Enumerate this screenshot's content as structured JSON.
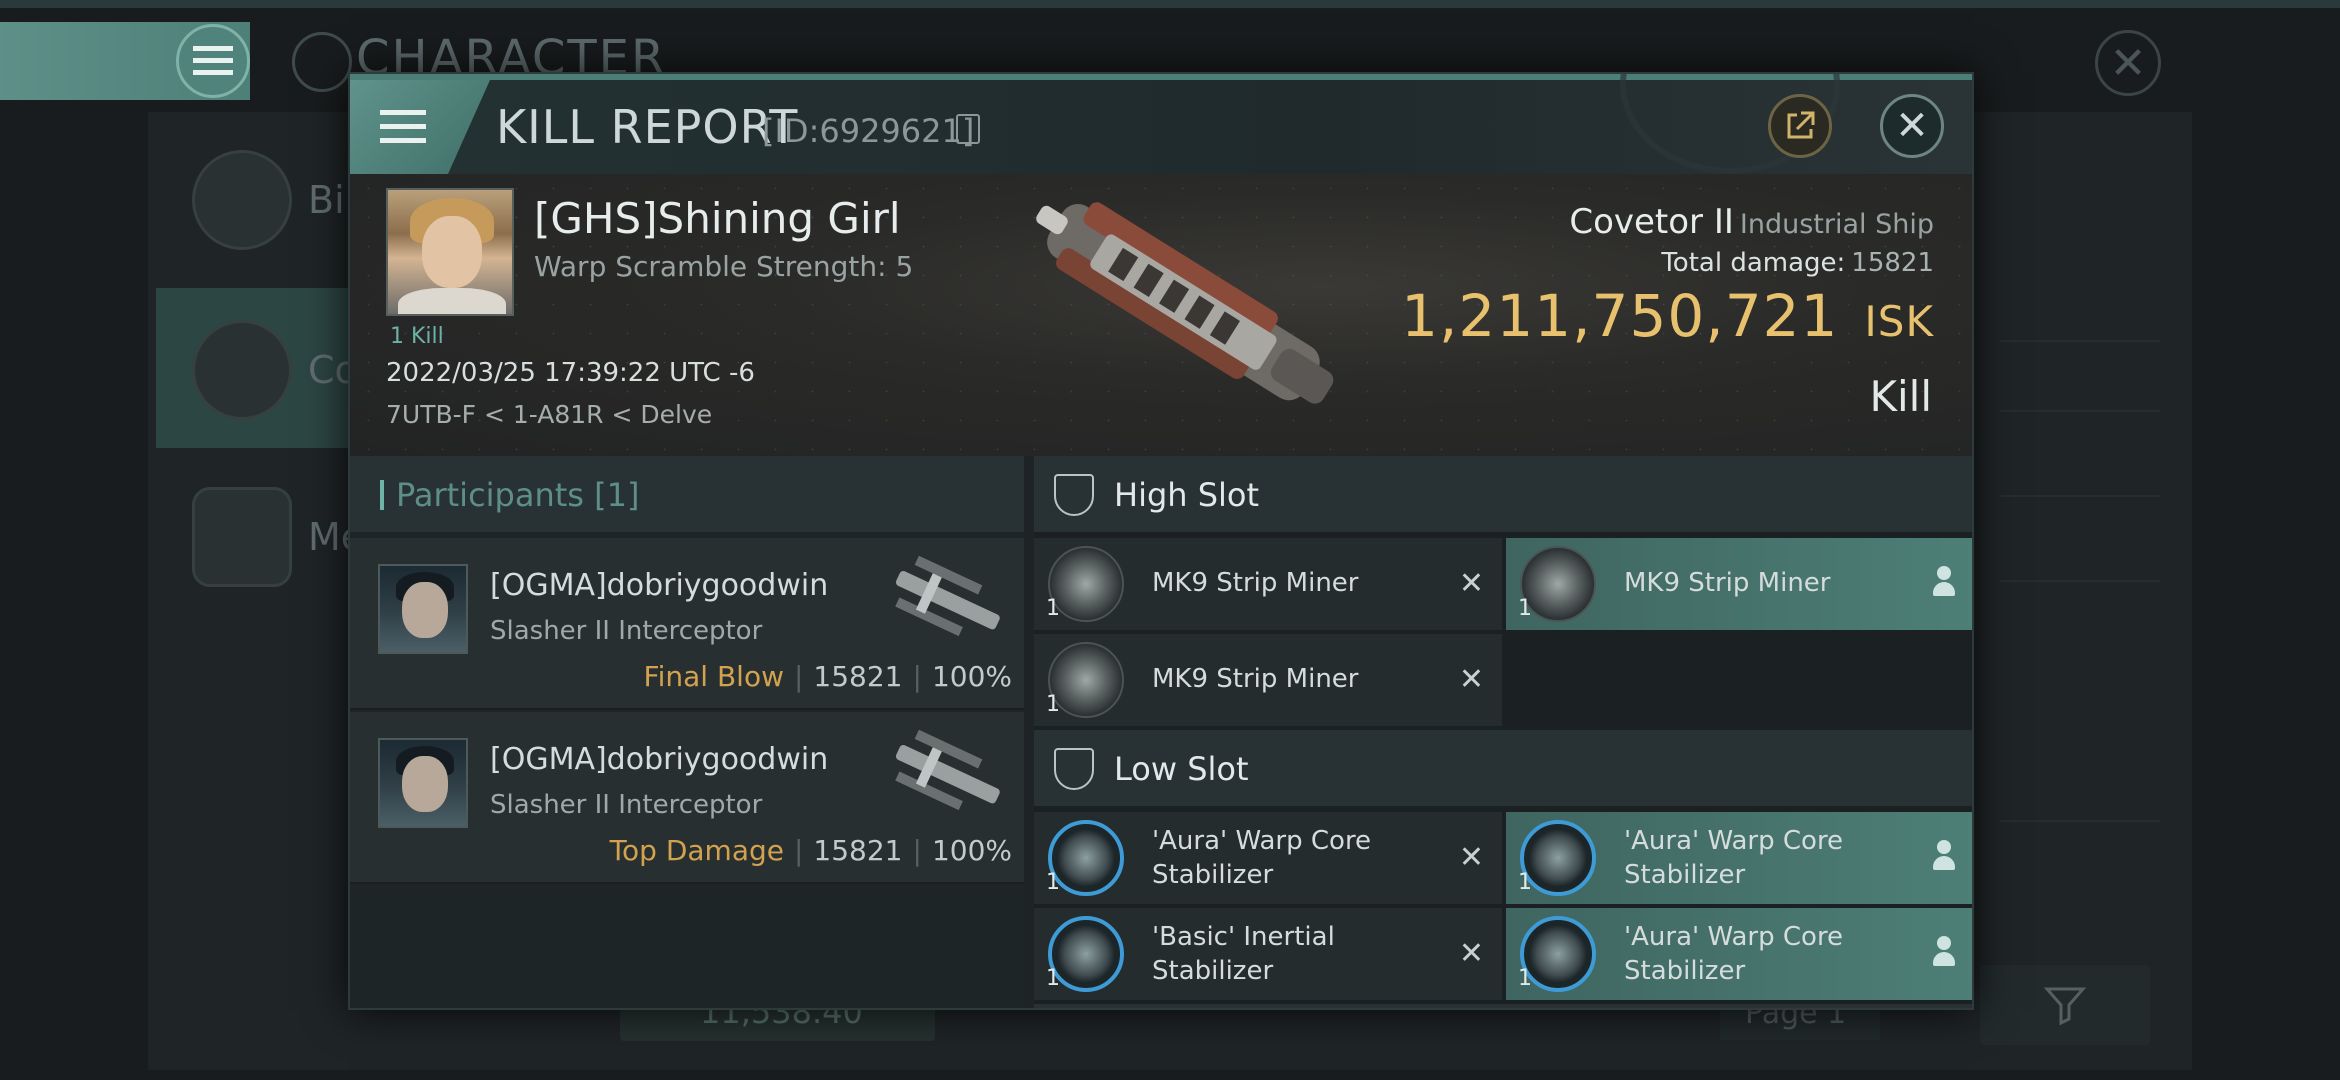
{
  "background": {
    "title": "CHARACTER",
    "side_items": [
      {
        "label": "Bi"
      },
      {
        "label": "Co"
      },
      {
        "label": "Me"
      }
    ],
    "bottom_value": "11,538.40",
    "page_label": "Page 1"
  },
  "modal": {
    "title": "KILL REPORT",
    "id_text": "[ID:6929621]",
    "victim": {
      "name": "[GHS]Shining Girl",
      "subtitle": "Warp Scramble Strength: 5",
      "kill_badge": "1 Kill",
      "datetime": "2022/03/25 17:39:22 UTC -6",
      "location": "7UTB-F < 1-A81R < Delve",
      "ship_name": "Covetor II",
      "ship_class": "Industrial Ship",
      "total_damage_label": "Total damage:",
      "total_damage": "15821",
      "isk_value": "1,211,750,721",
      "isk_unit": "ISK",
      "result": "Kill"
    },
    "participants": {
      "header": "Participants [1]",
      "rows": [
        {
          "name": "[OGMA]dobriygoodwin",
          "ship": "Slasher II Interceptor",
          "tag": "Final Blow",
          "damage": "15821",
          "percent": "100%"
        },
        {
          "name": "[OGMA]dobriygoodwin",
          "ship": "Slasher II Interceptor",
          "tag": "Top Damage",
          "damage": "15821",
          "percent": "100%"
        }
      ]
    },
    "high_slot": {
      "title": "High Slot",
      "items": [
        {
          "name": "MK9 Strip Miner",
          "qty": "1"
        },
        {
          "name": "MK9 Strip Miner",
          "qty": "1"
        },
        {
          "name": "MK9 Strip Miner",
          "qty": "1"
        }
      ]
    },
    "low_slot": {
      "title": "Low Slot",
      "items": [
        {
          "line1": "'Aura' Warp Core",
          "line2": "Stabilizer",
          "qty": "1"
        },
        {
          "line1": "'Aura' Warp Core",
          "line2": "Stabilizer",
          "qty": "1"
        },
        {
          "line1": "'Basic' Inertial",
          "line2": "Stabilizer",
          "qty": "1"
        },
        {
          "line1": "'Aura' Warp Core",
          "line2": "Stabilizer",
          "qty": "1"
        }
      ]
    }
  },
  "icons": {
    "menu": "hamburger-icon",
    "share": "external-link-icon",
    "close": "close-icon",
    "copy": "copy-icon",
    "destroyed": "x-mark-icon",
    "dropped": "person-icon",
    "slot": "shield-slot-icon"
  },
  "colors": {
    "accent": "#4e7f78",
    "isk": "#e8c16e",
    "final_blow": "#d3a24f"
  }
}
